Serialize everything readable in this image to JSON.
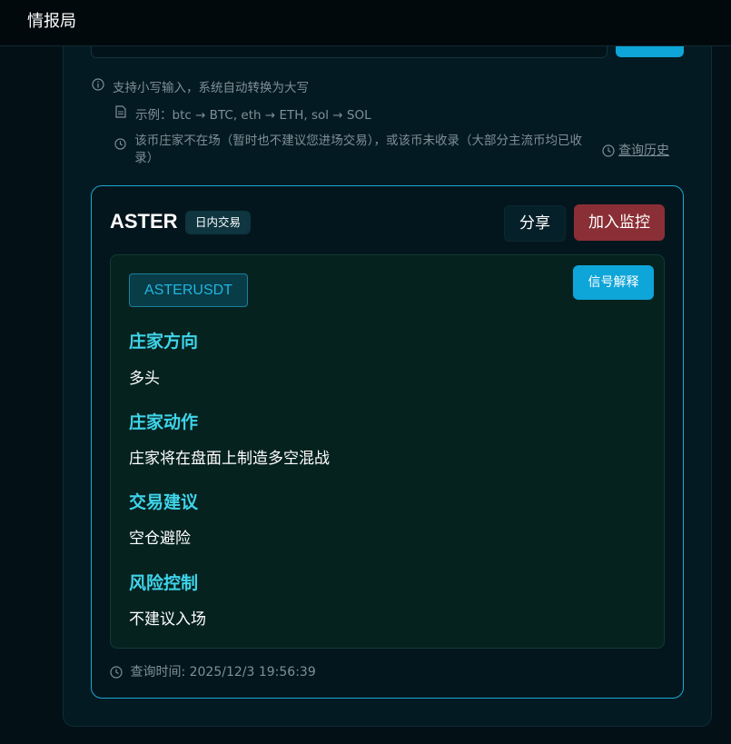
{
  "header": {
    "title": "情报局"
  },
  "hints": {
    "line1": "支持小写输入，系统自动转换为大写",
    "line2": "示例：btc → BTC, eth → ETH, sol → SOL",
    "line3": "该币庄家不在场（暂时也不建议您进场交易），或该币未收录（大部分主流币均已收录）"
  },
  "history_link": "查询历史",
  "result": {
    "coin": "ASTER",
    "tag": "日内交易",
    "share_label": "分享",
    "monitor_label": "加入监控",
    "symbol": "ASTERUSDT",
    "explain_label": "信号解释",
    "sections": [
      {
        "title": "庄家方向",
        "value": "多头"
      },
      {
        "title": "庄家动作",
        "value": "庄家将在盘面上制造多空混战"
      },
      {
        "title": "交易建议",
        "value": "空仓避险"
      },
      {
        "title": "风险控制",
        "value": "不建议入场"
      }
    ],
    "query_time": "查询时间: 2025/12/3 19:56:39"
  },
  "colors": {
    "accent": "#0ea5d8",
    "danger": "#8a2f35",
    "section_title": "#3fd4ea"
  }
}
